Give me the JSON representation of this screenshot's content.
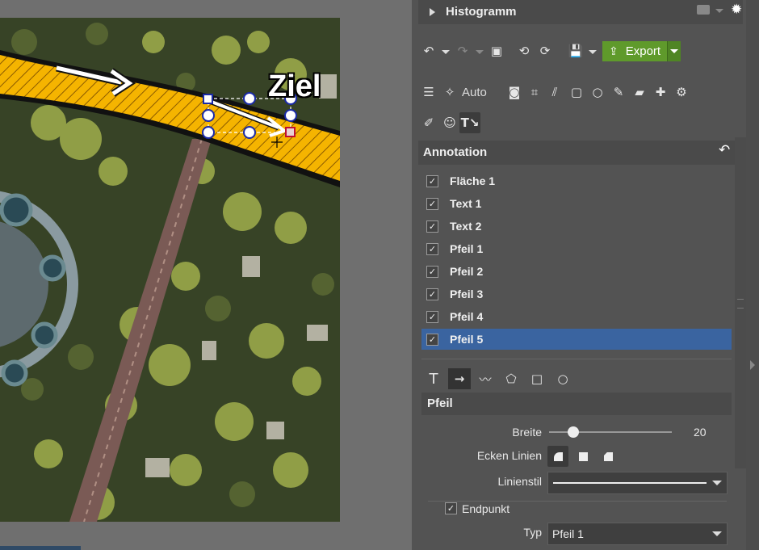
{
  "canvas": {
    "annotation_text": "Ziel"
  },
  "histogram": {
    "title": "Histogramm"
  },
  "toolbar": {
    "export_label": "Export",
    "auto_label": "Auto"
  },
  "annotation": {
    "title": "Annotation",
    "layers": [
      {
        "label": "Fläche 1",
        "checked": true,
        "selected": false
      },
      {
        "label": "Text 1",
        "checked": true,
        "selected": false
      },
      {
        "label": "Text 2",
        "checked": true,
        "selected": false
      },
      {
        "label": "Pfeil 1",
        "checked": true,
        "selected": false
      },
      {
        "label": "Pfeil 2",
        "checked": true,
        "selected": false
      },
      {
        "label": "Pfeil 3",
        "checked": true,
        "selected": false
      },
      {
        "label": "Pfeil 4",
        "checked": true,
        "selected": false
      },
      {
        "label": "Pfeil 5",
        "checked": true,
        "selected": true
      }
    ]
  },
  "pfeil": {
    "title": "Pfeil",
    "breite_label": "Breite",
    "breite_value": "20",
    "breite_fraction": 0.2,
    "ecken_label": "Ecken Linien",
    "linienstil_label": "Linienstil",
    "endpunkt_label": "Endpunkt",
    "endpunkt_checked": true,
    "typ_label": "Typ",
    "typ_value": "Pfeil 1"
  },
  "colors": {
    "selection": "#3a64a0",
    "export_green": "#5f9a2b",
    "annotation_yellow": "#f5b400",
    "handle_blue": "#1a2aa8"
  }
}
